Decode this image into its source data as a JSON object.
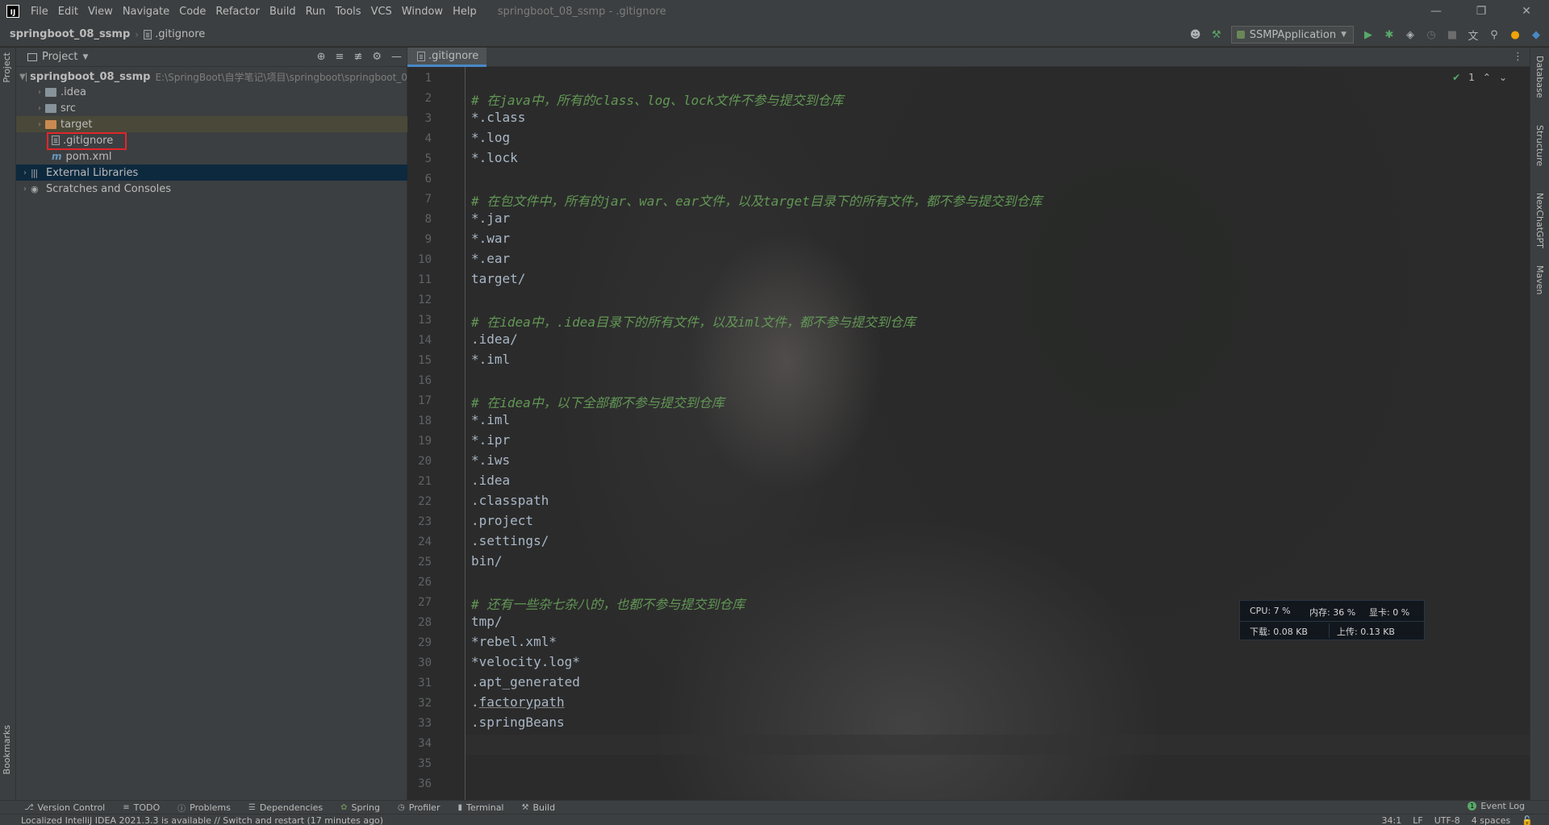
{
  "titlebar": {
    "logo": "IJ",
    "menu": [
      "File",
      "Edit",
      "View",
      "Navigate",
      "Code",
      "Refactor",
      "Build",
      "Run",
      "Tools",
      "VCS",
      "Window",
      "Help"
    ],
    "window_title": "springboot_08_ssmp - .gitignore",
    "controls": {
      "minimize": "—",
      "restore": "❐",
      "close": "✕"
    }
  },
  "navbar": {
    "project": "springboot_08_ssmp",
    "file": ".gitignore",
    "run_config": "SSMPApplication"
  },
  "left_strip": {
    "project_tab": "Project",
    "bookmarks_tab": "Bookmarks"
  },
  "project_panel": {
    "title": "Project",
    "tree": {
      "root": {
        "name": "springboot_08_ssmp",
        "path": "E:\\SpringBoot\\自学笔记\\项目\\springboot\\springboot_0"
      },
      "idea": ".idea",
      "src": "src",
      "target": "target",
      "gitignore": ".gitignore",
      "pom": "pom.xml",
      "external_libraries": "External Libraries",
      "scratches": "Scratches and Consoles"
    }
  },
  "editor": {
    "tab": ".gitignore",
    "inspection": {
      "count": "1"
    },
    "lines": [
      "1",
      "2",
      "3",
      "4",
      "5",
      "6",
      "7",
      "8",
      "9",
      "10",
      "11",
      "12",
      "13",
      "14",
      "15",
      "16",
      "17",
      "18",
      "19",
      "20",
      "21",
      "22",
      "23",
      "24",
      "25",
      "26",
      "27",
      "28",
      "29",
      "30",
      "31",
      "32",
      "33",
      "34",
      "35",
      "36"
    ],
    "code": {
      "l2": "# 在java中，所有的class、log、lock文件不参与提交到仓库",
      "l3": "*.class",
      "l4": "*.log",
      "l5": "*.lock",
      "l7": "# 在包文件中，所有的jar、war、ear文件，以及target目录下的所有文件，都不参与提交到仓库",
      "l8": "*.jar",
      "l9": "*.war",
      "l10": "*.ear",
      "l11": "target/",
      "l13": "# 在idea中，.idea目录下的所有文件，以及iml文件，都不参与提交到仓库",
      "l14": ".idea/",
      "l15": "*.iml",
      "l17": "# 在idea中，以下全部都不参与提交到仓库",
      "l18": "*.iml",
      "l19": "*.ipr",
      "l20": "*.iws",
      "l21": ".idea",
      "l22": ".classpath",
      "l23": ".project",
      "l24": ".settings/",
      "l25": "bin/",
      "l27": "# 还有一些杂七杂八的，也都不参与提交到仓库",
      "l28": "tmp/",
      "l29": "*rebel.xml*",
      "l30": "*velocity.log*",
      "l31": ".apt_generated",
      "l32_dot": ".",
      "l32_word": "factorypath",
      "l33": ".springBeans"
    }
  },
  "monitor": {
    "cpu": "CPU: 7 %",
    "mem": "内存: 36 %",
    "gpu": "显卡: 0 %",
    "down": "下载: 0.08 KB",
    "up": "上传: 0.13 KB"
  },
  "right_strip": [
    "Database",
    "Structure",
    "NexChatGPT",
    "Maven"
  ],
  "bottombar": {
    "items": [
      "Version Control",
      "TODO",
      "Problems",
      "Dependencies",
      "Spring",
      "Profiler",
      "Terminal",
      "Build"
    ],
    "event_log": "Event Log",
    "event_count": "1"
  },
  "statusbar": {
    "message": "Localized IntelliJ IDEA 2021.3.3 is available // Switch and restart (17 minutes ago)",
    "position": "34:1",
    "line_sep": "LF",
    "encoding": "UTF-8",
    "indent": "4 spaces"
  },
  "colors": {
    "comment": "#629755",
    "code": "#a9b7c6",
    "highlight_box": "#e0262a",
    "selection": "#0d293e"
  }
}
